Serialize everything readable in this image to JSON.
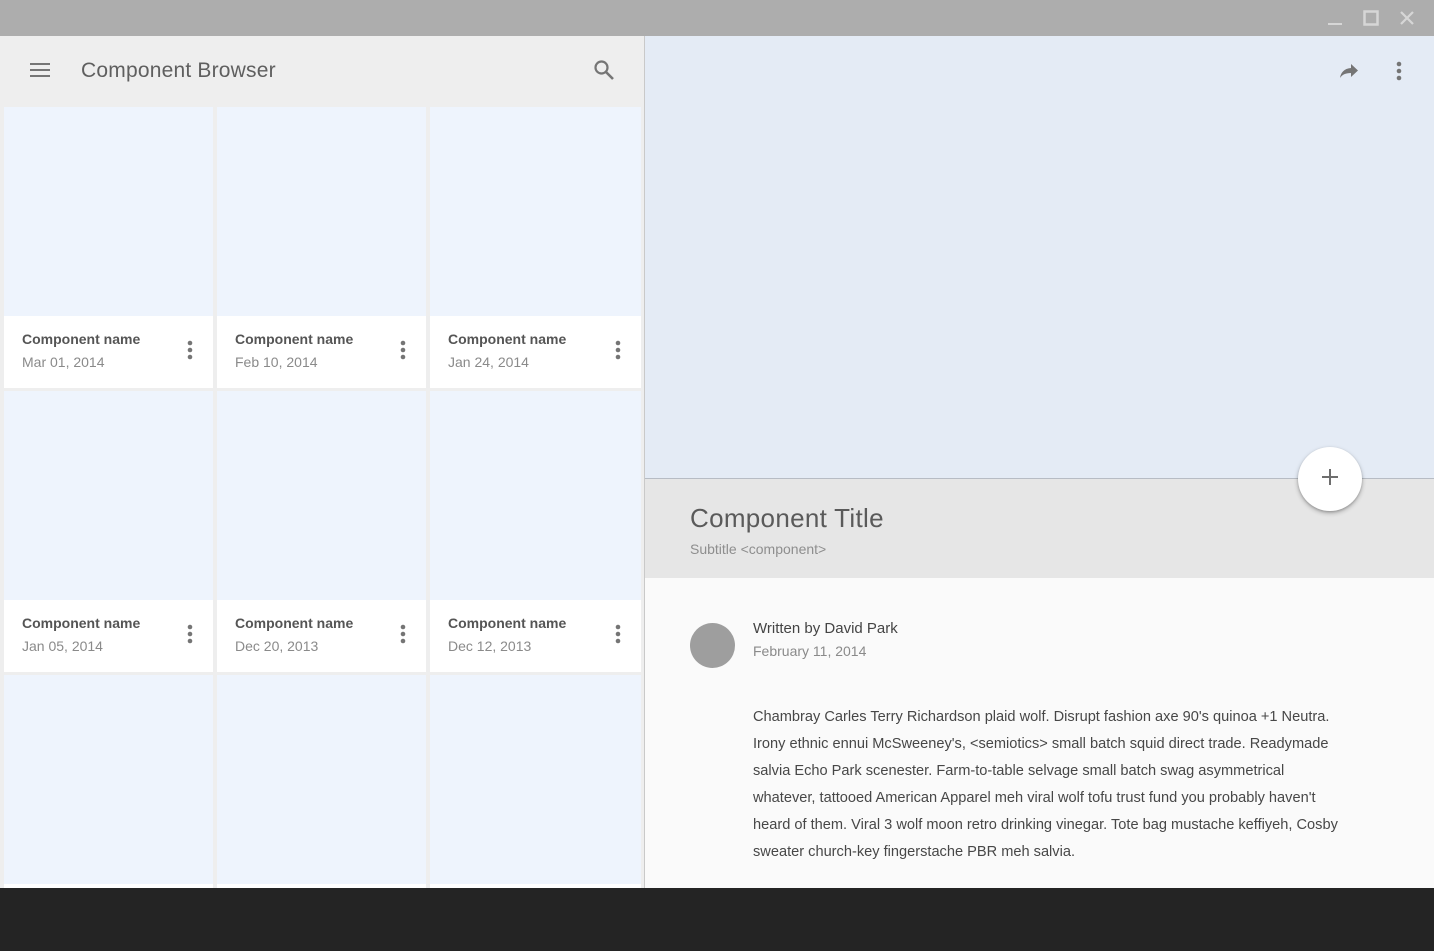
{
  "window": {
    "controls": [
      {
        "name": "minimize-button",
        "icon": "minimize-icon"
      },
      {
        "name": "maximize-button",
        "icon": "maximize-icon"
      },
      {
        "name": "close-button",
        "icon": "close-icon"
      }
    ]
  },
  "browser": {
    "title": "Component Browser",
    "menu_icon": "hamburger-menu-icon",
    "search_icon": "search-icon",
    "cards": [
      {
        "name": "Component name",
        "date": "Mar 01, 2014"
      },
      {
        "name": "Component name",
        "date": "Feb 10, 2014"
      },
      {
        "name": "Component name",
        "date": "Jan 24, 2014"
      },
      {
        "name": "Component name",
        "date": "Jan 05, 2014"
      },
      {
        "name": "Component name",
        "date": "Dec 20, 2013"
      },
      {
        "name": "Component name",
        "date": "Dec 12, 2013"
      },
      {
        "name": "",
        "date": ""
      },
      {
        "name": "",
        "date": ""
      },
      {
        "name": "",
        "date": ""
      }
    ]
  },
  "detail": {
    "share_icon": "share-icon",
    "more_icon": "more-vert-icon",
    "fab_icon": "plus-icon",
    "title": "Component Title",
    "subtitle": "Subtitle <component>",
    "author": "Written by David Park",
    "date": "February 11, 2014",
    "body": "Chambray Carles Terry Richardson plaid wolf. Disrupt fashion axe 90's quinoa +1 Neutra. Irony ethnic ennui McSweeney's, <semiotics> small batch squid direct trade. Readymade salvia Echo Park scenester. Farm-to-table selvage small batch swag asymmetrical whatever, tattooed American Apparel meh viral wolf tofu trust fund you probably haven't heard of them. Viral 3 wolf moon retro drinking  vinegar. Tote bag mustache keffiyeh, Cosby sweater church-key fingerstache PBR meh salvia."
  },
  "colors": {
    "titlebar": "#adadad",
    "panel_bg": "#eeeeee",
    "thumbnail": "#eef4fd",
    "hero": "#e4ebf5",
    "title_block": "#e6e6e6",
    "icon": "#757575",
    "avatar": "#9e9e9e"
  }
}
